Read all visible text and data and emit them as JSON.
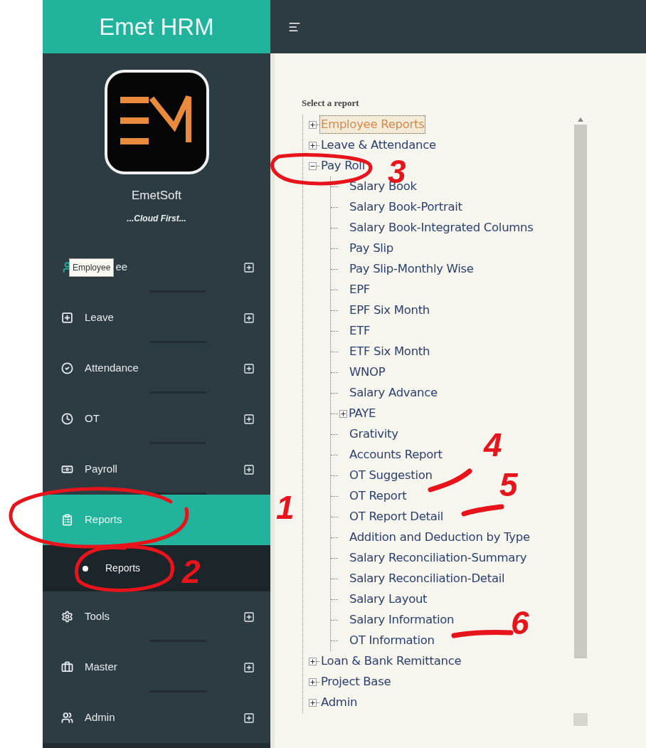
{
  "sidebar": {
    "app_title": "Emet HRM",
    "company": "EmetSoft",
    "tagline": "...Cloud First...",
    "items": [
      {
        "kind": "employee",
        "label": "ee",
        "tooltip": "Employee",
        "selected": false,
        "expanded": false
      },
      {
        "kind": "leave",
        "label": "Leave",
        "selected": false,
        "expanded": false
      },
      {
        "kind": "attendance",
        "label": "Attendance",
        "selected": false,
        "expanded": false
      },
      {
        "kind": "ot",
        "label": "OT",
        "selected": false,
        "expanded": false
      },
      {
        "kind": "payroll",
        "label": "Payroll",
        "selected": false,
        "expanded": false
      },
      {
        "kind": "reports",
        "label": "Reports",
        "selected": true,
        "expanded": true,
        "children": [
          {
            "label": "Reports",
            "selected": true
          }
        ]
      },
      {
        "kind": "tools",
        "label": "Tools",
        "selected": false,
        "expanded": false
      },
      {
        "kind": "master",
        "label": "Master",
        "selected": false,
        "expanded": false
      },
      {
        "kind": "admin",
        "label": "Admin",
        "selected": false,
        "expanded": false
      }
    ]
  },
  "report_tree": {
    "title": "Select a report",
    "items": [
      {
        "label": "Employee Reports",
        "expanded": false,
        "selected": true
      },
      {
        "label": "Leave & Attendance",
        "expanded": false,
        "selected": false
      },
      {
        "label": "Pay Roll",
        "expanded": true,
        "selected": false,
        "children": [
          {
            "label": "Salary Book",
            "selected": false
          },
          {
            "label": "Salary Book-Portrait",
            "selected": false
          },
          {
            "label": "Salary Book-Integrated Columns",
            "selected": false
          },
          {
            "label": "Pay Slip",
            "selected": false
          },
          {
            "label": "Pay Slip-Monthly Wise",
            "selected": false
          },
          {
            "label": "EPF",
            "selected": false
          },
          {
            "label": "EPF Six Month",
            "selected": false
          },
          {
            "label": "ETF",
            "selected": false
          },
          {
            "label": "ETF Six Month",
            "selected": false
          },
          {
            "label": "WNOP",
            "selected": false
          },
          {
            "label": "Salary Advance",
            "selected": false
          },
          {
            "label": "PAYE",
            "expanded": false,
            "selected": false
          },
          {
            "label": "Grativity",
            "selected": false
          },
          {
            "label": "Accounts Report",
            "selected": false
          },
          {
            "label": "OT Suggestion",
            "selected": false
          },
          {
            "label": "OT Report",
            "selected": false
          },
          {
            "label": "OT Report Detail",
            "selected": false
          },
          {
            "label": "Addition and Deduction by Type",
            "selected": false
          },
          {
            "label": "Salary Reconciliation-Summary",
            "selected": false
          },
          {
            "label": "Salary Reconciliation-Detail",
            "selected": false
          },
          {
            "label": "Salary Layout",
            "selected": false
          },
          {
            "label": "Salary Information",
            "selected": false
          },
          {
            "label": "OT Information",
            "selected": false
          }
        ]
      },
      {
        "label": "Loan & Bank Remittance",
        "expanded": false,
        "selected": false
      },
      {
        "label": "Project Base",
        "expanded": false,
        "selected": false
      },
      {
        "label": "Admin",
        "expanded": false,
        "selected": false
      }
    ]
  },
  "annotations": [
    {
      "kind": "circle",
      "label": "1"
    },
    {
      "kind": "circle",
      "label": "2"
    },
    {
      "kind": "circle",
      "label": "3"
    },
    {
      "kind": "stroke",
      "label": "4"
    },
    {
      "kind": "stroke",
      "label": "5"
    },
    {
      "kind": "stroke",
      "label": "6"
    }
  ]
}
